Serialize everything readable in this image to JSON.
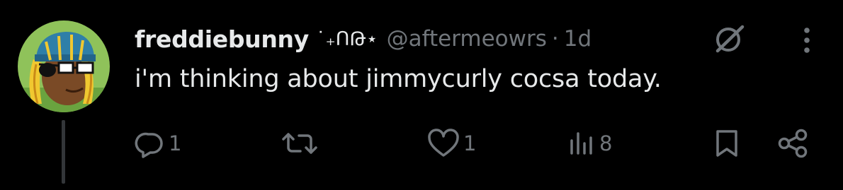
{
  "tweet": {
    "display_name": "freddiebunny",
    "name_decoration": "˙₊ՈԹ⋆",
    "handle": "@aftermeowrs",
    "separator": "·",
    "timestamp": "1d",
    "text": "i'm thinking about jimmycurly cocsa today."
  },
  "actions": {
    "reply_count": "1",
    "repost_count": "",
    "like_count": "1",
    "views_count": "8"
  },
  "icons": {
    "reply": "reply-icon",
    "repost": "repost-icon",
    "like": "heart-icon",
    "views": "views-icon",
    "bookmark": "bookmark-icon",
    "share": "share-icon",
    "grok": "grok-icon",
    "more": "more-icon"
  },
  "colors": {
    "background": "#000000",
    "primary_text": "#e7e9ea",
    "secondary_text": "#71767b",
    "thread_line": "#333639"
  }
}
